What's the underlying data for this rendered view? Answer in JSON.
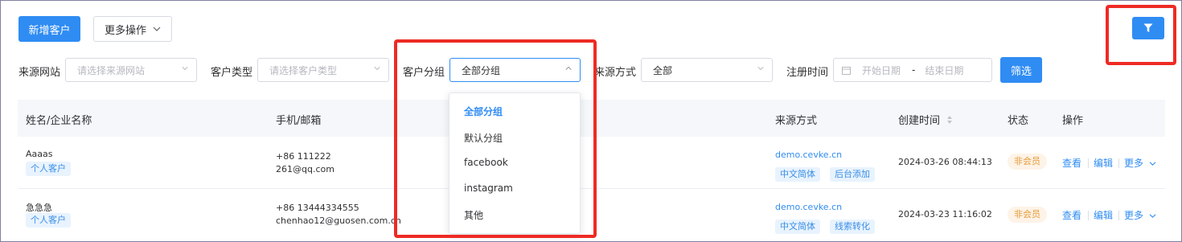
{
  "toolbar": {
    "add_customer": "新增客户",
    "more_actions": "更多操作"
  },
  "filters": {
    "source_site": {
      "label": "来源网站",
      "placeholder": "请选择来源网站"
    },
    "customer_type": {
      "label": "客户类型",
      "placeholder": "请选择客户类型"
    },
    "customer_group": {
      "label": "客户分组",
      "value": "全部分组"
    },
    "source_method": {
      "label": "来源方式",
      "value": "全部"
    },
    "register_time": {
      "label": "注册时间",
      "start_placeholder": "开始日期",
      "separator": "-",
      "end_placeholder": "结束日期"
    },
    "filter_button": "筛选"
  },
  "table": {
    "columns": {
      "name": "姓名/企业名称",
      "contact": "手机/邮箱",
      "source": "来源方式",
      "created": "创建时间",
      "status": "状态",
      "actions": "操作"
    },
    "rows": [
      {
        "name": "Aaaas",
        "type_tag": "个人客户",
        "phone": "+86 111222",
        "email": "261@qq.com",
        "source_site": "demo.cevke.cn",
        "tags": [
          "中文简体",
          "后台添加"
        ],
        "created": "2024-03-26 08:44:13",
        "status": "非会员",
        "view": "查看",
        "edit": "编辑",
        "more": "更多"
      },
      {
        "name": "急急急",
        "type_tag": "个人客户",
        "phone": "+86 13444334555",
        "email": "chenhao12@guosen.com.cn",
        "source_site": "demo.cevke.cn",
        "tags": [
          "中文简体",
          "线索转化"
        ],
        "created": "2024-03-23 11:16:02",
        "status": "非会员",
        "view": "查看",
        "edit": "编辑",
        "more": "更多"
      }
    ]
  },
  "group_dropdown": {
    "options": [
      "全部分组",
      "默认分组",
      "facebook",
      "instagram",
      "其他"
    ],
    "selected_index": 0
  },
  "icons": {
    "filter_toggle": "funnel-icon",
    "chevron": "chevron-down-icon",
    "calendar": "calendar-icon",
    "sort": "sort-icon"
  },
  "colors": {
    "primary": "#2f8cf3",
    "highlight_box": "#ee2a24",
    "tag_blue_bg": "#e8f3fe",
    "tag_orange_text": "#e89a36"
  }
}
